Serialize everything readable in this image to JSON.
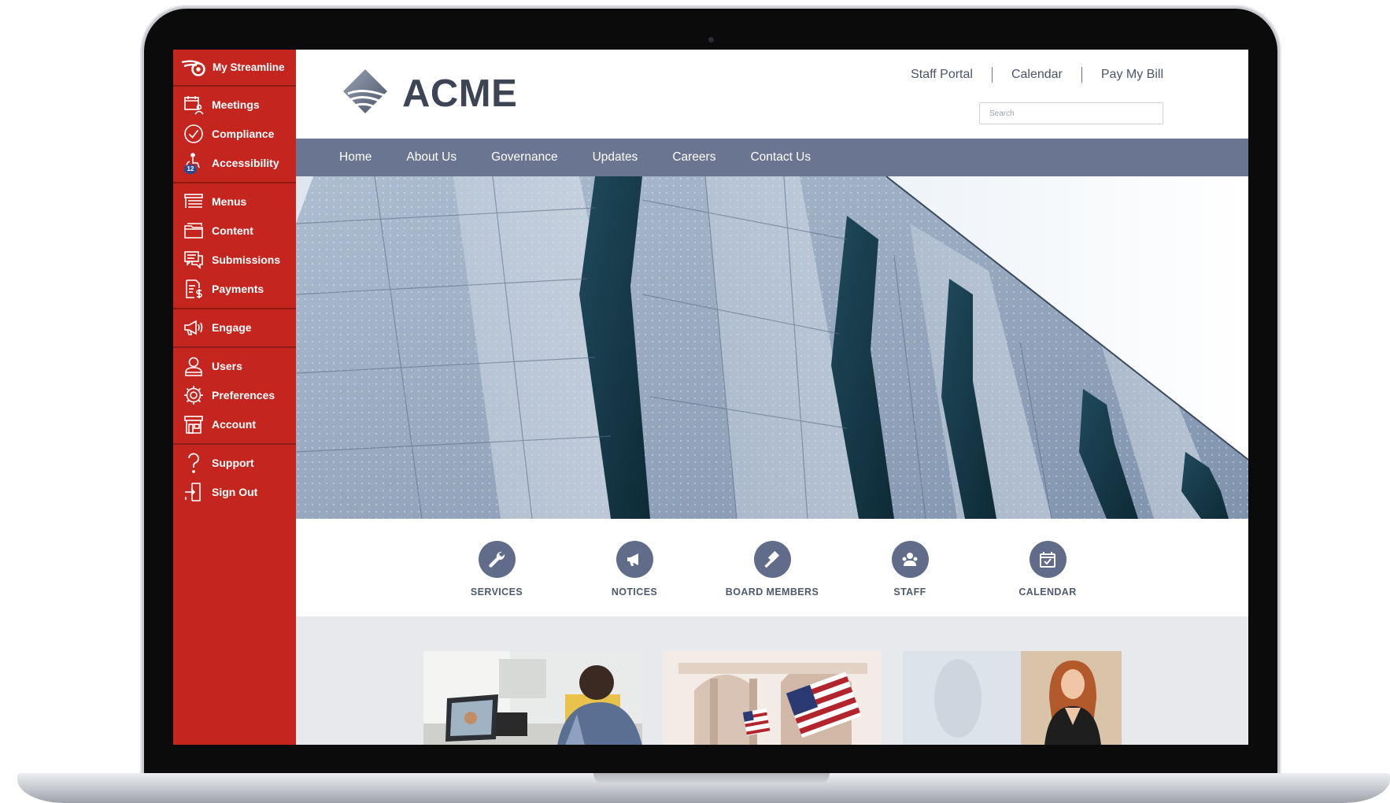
{
  "cms": {
    "title": "My Streamline",
    "groups": [
      [
        {
          "label": "Meetings",
          "icon": "calendar-people-icon"
        },
        {
          "label": "Compliance",
          "icon": "check-circle-icon"
        },
        {
          "label": "Accessibility",
          "icon": "accessibility-icon",
          "badge": "12"
        }
      ],
      [
        {
          "label": "Menus",
          "icon": "menu-icon"
        },
        {
          "label": "Content",
          "icon": "folder-icon"
        },
        {
          "label": "Submissions",
          "icon": "chat-bubbles-icon"
        },
        {
          "label": "Payments",
          "icon": "invoice-dollar-icon"
        }
      ],
      [
        {
          "label": "Engage",
          "icon": "megaphone-icon"
        }
      ],
      [
        {
          "label": "Users",
          "icon": "user-icon"
        },
        {
          "label": "Preferences",
          "icon": "gear-icon"
        },
        {
          "label": "Account",
          "icon": "storefront-icon"
        }
      ],
      [
        {
          "label": "Support",
          "icon": "question-icon"
        },
        {
          "label": "Sign Out",
          "icon": "sign-out-icon"
        }
      ]
    ]
  },
  "site": {
    "brand": "ACME",
    "utility_links": [
      "Staff Portal",
      "Calendar",
      "Pay My Bill"
    ],
    "search_placeholder": "Search",
    "nav": [
      "Home",
      "About Us",
      "Governance",
      "Updates",
      "Careers",
      "Contact Us"
    ],
    "quick_links": [
      {
        "label": "SERVICES",
        "icon": "wrench-icon"
      },
      {
        "label": "NOTICES",
        "icon": "megaphone-icon"
      },
      {
        "label": "BOARD MEMBERS",
        "icon": "gavel-icon"
      },
      {
        "label": "STAFF",
        "icon": "people-icon"
      },
      {
        "label": "CALENDAR",
        "icon": "calendar-check-icon"
      }
    ]
  },
  "colors": {
    "cms_red": "#c4261f",
    "nav_slate": "#6a7591",
    "icon_slate": "#606c89",
    "brand_text": "#3d4555"
  }
}
